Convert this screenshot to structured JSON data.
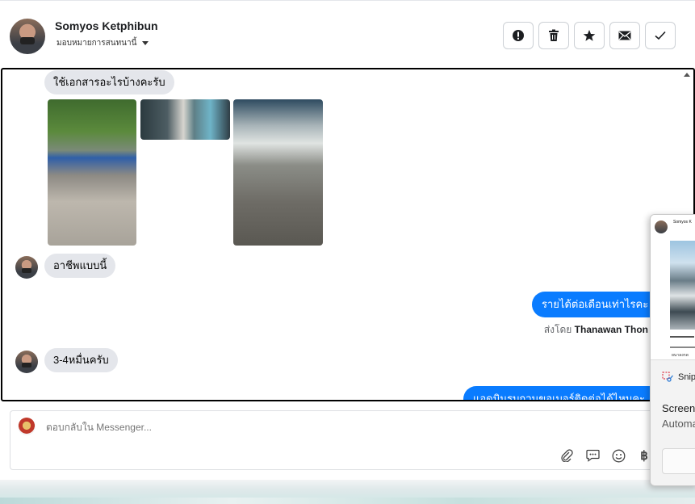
{
  "header": {
    "contact_name": "Somyos Ketphibun",
    "assign_label": "มอบหมายการสนทนานี้",
    "actions": [
      {
        "name": "report",
        "icon": "exclamation-circle-icon"
      },
      {
        "name": "delete",
        "icon": "trash-icon"
      },
      {
        "name": "star",
        "icon": "star-icon"
      },
      {
        "name": "mark-unread",
        "icon": "envelope-icon"
      },
      {
        "name": "mark-done",
        "icon": "check-icon"
      }
    ]
  },
  "messages": {
    "m1": "ใช้เอกสารอะไรบ้างคะรับ",
    "m2": "อาชีพแบบนี้",
    "m3": "รายได้ต่อเดือนเท่าไรคะ",
    "m4": "3-4หมื่นครับ",
    "m5": "แอดมินรบกวนขอเบอร์ติดต่อได้ไหมคะ",
    "sent_by_prefix": "ส่งโดย",
    "sent_by_name": "Thanawan Thon"
  },
  "composer": {
    "placeholder": "ตอบกลับใน Messenger...",
    "icons": [
      "paperclip-icon",
      "chat-bubble-icon",
      "smiley-icon",
      "baht-icon"
    ]
  },
  "notification": {
    "thumb_name": "Somyos K",
    "thumb_footer": "ยนาลงกด",
    "app_name": "Snipping Tool",
    "title": "Screenshot copied to clipboard",
    "subtitle": "Automatically saved to screenshots folder"
  },
  "colors": {
    "outgoing_bubble": "#0a7cff",
    "incoming_bubble": "#e4e6eb"
  }
}
